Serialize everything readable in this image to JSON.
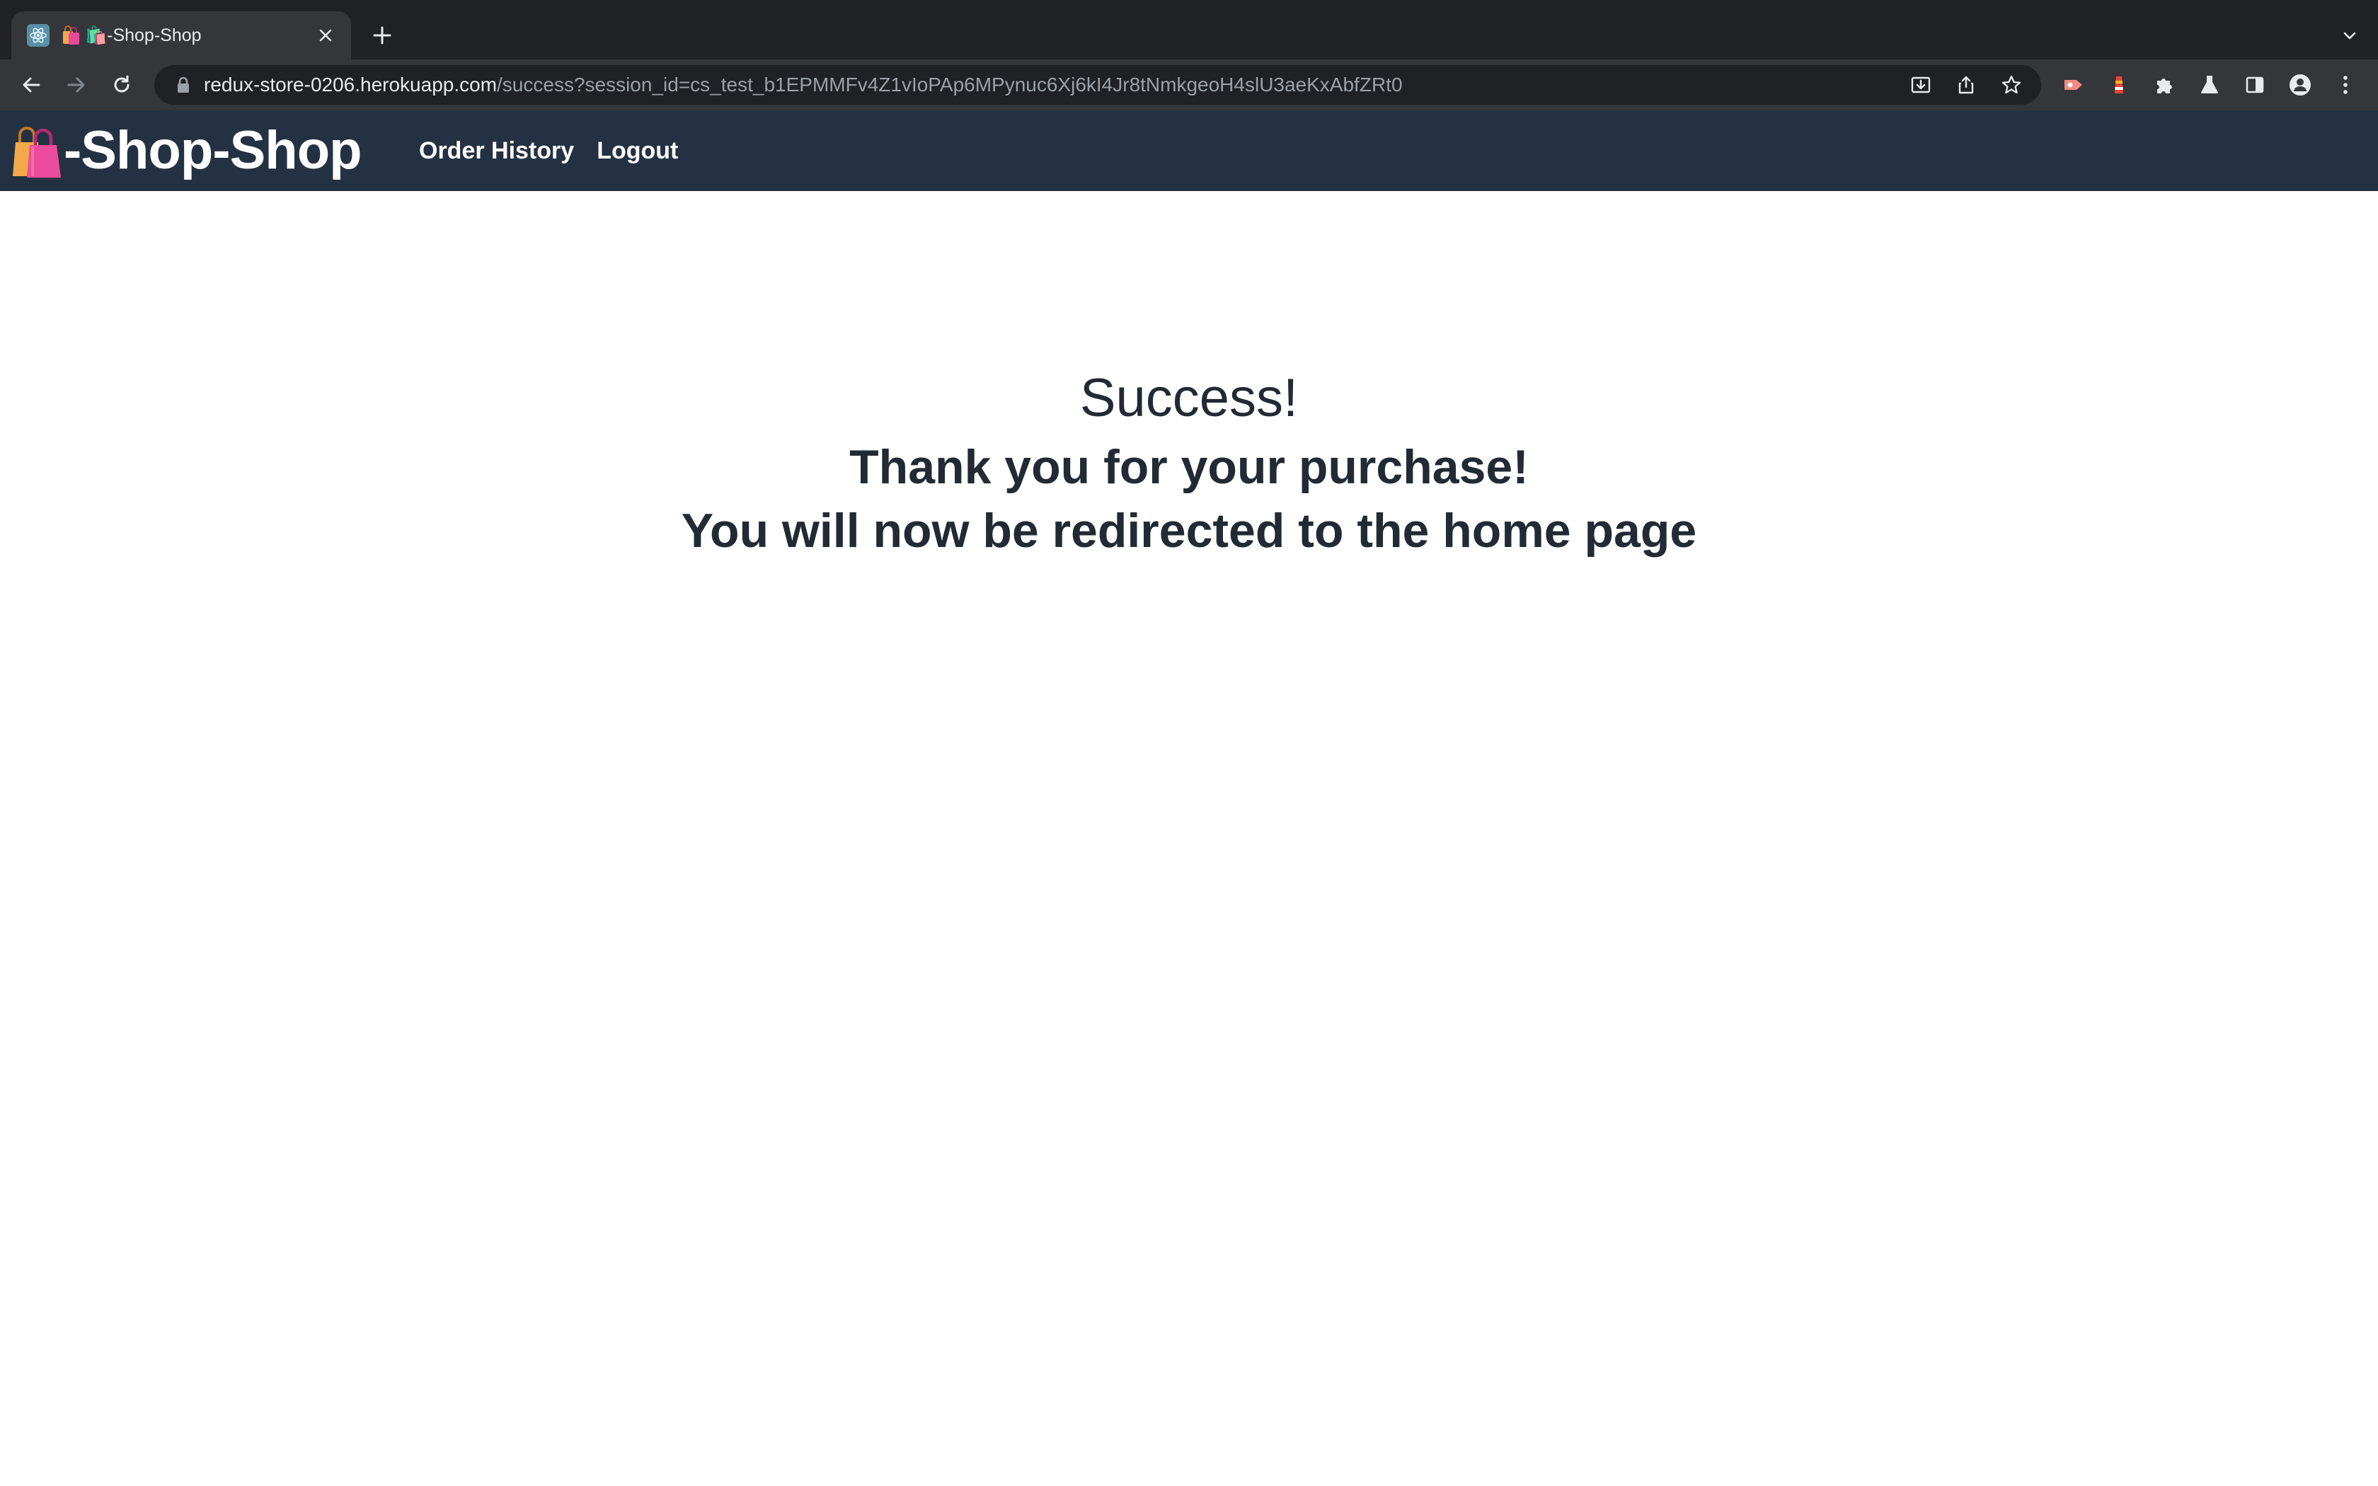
{
  "browser": {
    "tab": {
      "title": "🛍️-Shop-Shop",
      "favicon_name": "react-icon",
      "emoji_name": "shopping-bags-icon"
    },
    "address_bar": {
      "host": "redux-store-0206.herokuapp.com",
      "path": "/success?session_id=cs_test_b1EPMMFv4Z1vIoPAp6MPynuc6Xj6kI4Jr8tNmkgeoH4slU3aeKxAbfZRt0"
    },
    "colors": {
      "tabstrip": "#202124",
      "toolbar": "#35363a",
      "omnibox": "#202124"
    }
  },
  "site": {
    "brand": {
      "emoji_name": "shopping-bags-icon",
      "text": "-Shop-Shop"
    },
    "nav": {
      "order_history": "Order History",
      "logout": "Logout"
    },
    "colors": {
      "header_bg": "#243142",
      "text": "#222a33"
    }
  },
  "main": {
    "heading": "Success!",
    "thanks": "Thank you for your purchase!",
    "redirect": "You will now be redirected to the home page"
  }
}
